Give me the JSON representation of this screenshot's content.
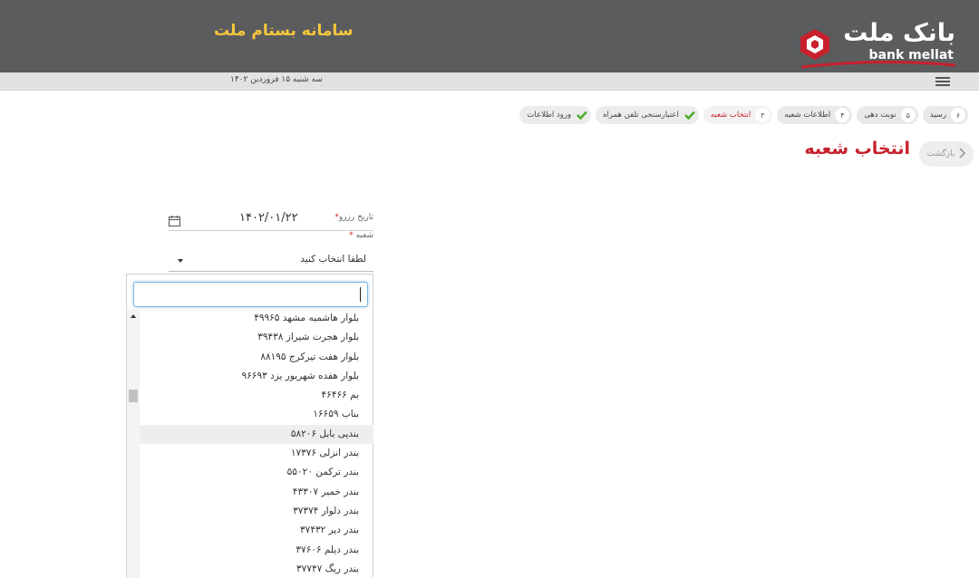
{
  "header": {
    "app_title": "سامانه بستام ملت",
    "logo_fa": "بانک ملت",
    "logo_en": "bank mellat",
    "colors": {
      "background": "#5b5c5e",
      "title": "#f6c63c",
      "brand_red": "#c8202c"
    }
  },
  "subbar": {
    "date": "سه شنبه ۱۵ فروردین ۱۴۰۲"
  },
  "steps": [
    {
      "num": "",
      "label": "ورود اطلاعات",
      "state": "done"
    },
    {
      "num": "",
      "label": "اعتبارسنجی تلفن همراه",
      "state": "done"
    },
    {
      "num": "۳",
      "label": "انتخاب شعبه",
      "state": "active"
    },
    {
      "num": "۴",
      "label": "اطلاعات شعبه",
      "state": "pending"
    },
    {
      "num": "۵",
      "label": "نوبت دهی",
      "state": "pending"
    },
    {
      "num": "۶",
      "label": "رسید",
      "state": "pending"
    }
  ],
  "page": {
    "back_label": "بازگشت",
    "title": "انتخاب شعبه"
  },
  "form": {
    "date_label": "تاریخ رزرو",
    "date_value": "۱۴۰۲/۰۱/۲۲",
    "branch_label": "شعبه",
    "required_mark": "*",
    "branch_placeholder": "لطفا انتخاب کنید"
  },
  "dropdown": {
    "search_value": "",
    "items": [
      "بلوار هاشمیه مشهد ۴۹۹۶۵",
      "بلوار هجرت شیراز ۳۹۴۳۸",
      "بلوار هفت تیرکرج ۸۸۱۹۵",
      "بلوار هفده شهریور یزد ۹۶۶۹۳",
      "بم ۴۶۴۶۶",
      "بناب ۱۶۶۵۹",
      "بندپی بابل ۵۸۲۰۶",
      "بندر انزلی ۱۷۳۷۶",
      "بندر ترکمن ۵۵۰۲۰",
      "بندر خمیر ۴۳۳۰۷",
      "بندر دلوار ۳۷۳۷۴",
      "بندر دیر ۳۷۴۳۲",
      "بندر دیلم ۳۷۶۰۶",
      "بندر ریگ ۳۷۷۴۷"
    ],
    "highlighted_index": 6
  }
}
